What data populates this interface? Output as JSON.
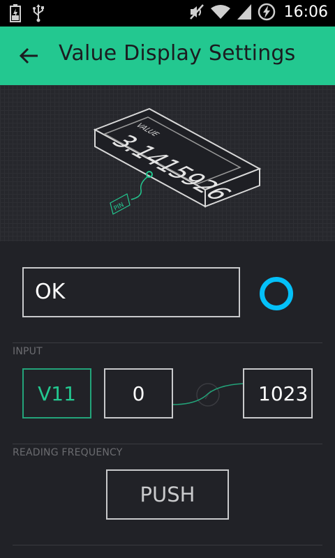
{
  "status_bar": {
    "time": "16:06",
    "icons": [
      "battery-charging-icon",
      "usb-icon",
      "mute-icon",
      "wifi-icon",
      "signal-icon",
      "power-saving-icon"
    ]
  },
  "header": {
    "back_icon": "arrow-left-icon",
    "title": "Value Display Settings"
  },
  "illustration": {
    "device_label": "VALUE",
    "device_value": "3.1415926",
    "pin_label": "PIN"
  },
  "name_field": {
    "value": "OK"
  },
  "color_picker": {
    "color": "#04c0f8"
  },
  "input_section": {
    "label": "INPUT",
    "pin": "V11",
    "min": "0",
    "max": "1023"
  },
  "frequency_section": {
    "label": "READING FREQUENCY",
    "value": "PUSH"
  },
  "colors": {
    "accent": "#23c890",
    "background": "#212227",
    "selection": "#04c0f8"
  }
}
